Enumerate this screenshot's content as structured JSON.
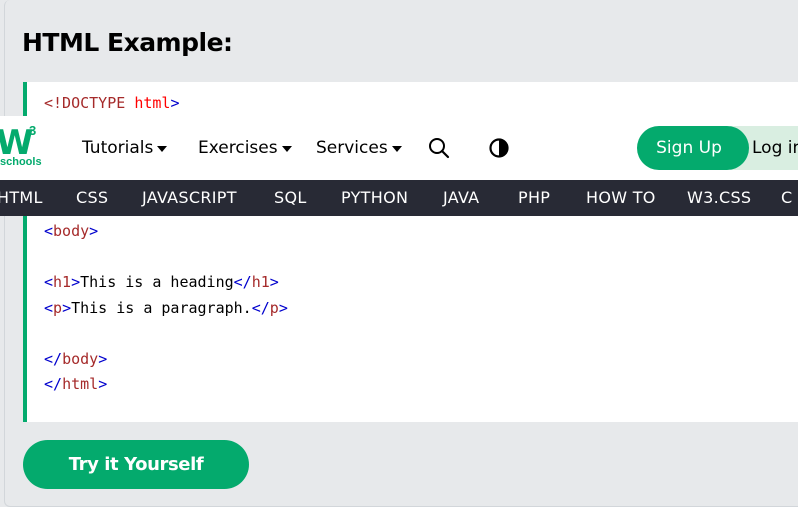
{
  "example": {
    "title": "HTML Example:",
    "try_button": "Try it Yourself"
  },
  "code": {
    "doctype_open": "<!DOCTYPE ",
    "doctype_attr": "html",
    "doctype_close": ">",
    "body_open_lt": "<",
    "body_open_name": "body",
    "body_open_gt": ">",
    "h1_open_lt": "<",
    "h1_open_name": "h1",
    "h1_open_gt": ">",
    "h1_text": "This is a heading",
    "h1_close_lt": "</",
    "h1_close_name": "h1",
    "h1_close_gt": ">",
    "p_open_lt": "<",
    "p_open_name": "p",
    "p_open_gt": ">",
    "p_text": "This is a paragraph.",
    "p_close_lt": "</",
    "p_close_name": "p",
    "p_close_gt": ">",
    "body_close_lt": "</",
    "body_close_name": "body",
    "body_close_gt": ">",
    "html_close_lt": "</",
    "html_close_name": "html",
    "html_close_gt": ">"
  },
  "topnav": {
    "logo_mark": "W",
    "logo_sup": "3",
    "logo_text": "schools",
    "tutorials": "Tutorials",
    "exercises": "Exercises",
    "services": "Services",
    "signup": "Sign Up",
    "login": "Log in"
  },
  "subnav": {
    "items": [
      "HTML",
      "CSS",
      "JAVASCRIPT",
      "SQL",
      "PYTHON",
      "JAVA",
      "PHP",
      "HOW TO",
      "W3.CSS",
      "C"
    ]
  },
  "colors": {
    "brand_green": "#04aa6d",
    "subnav_bg": "#282a35",
    "page_bg": "#e7e9eb"
  },
  "icons": {
    "search": "search-icon",
    "contrast": "contrast-icon",
    "caret": "caret-down-icon"
  }
}
